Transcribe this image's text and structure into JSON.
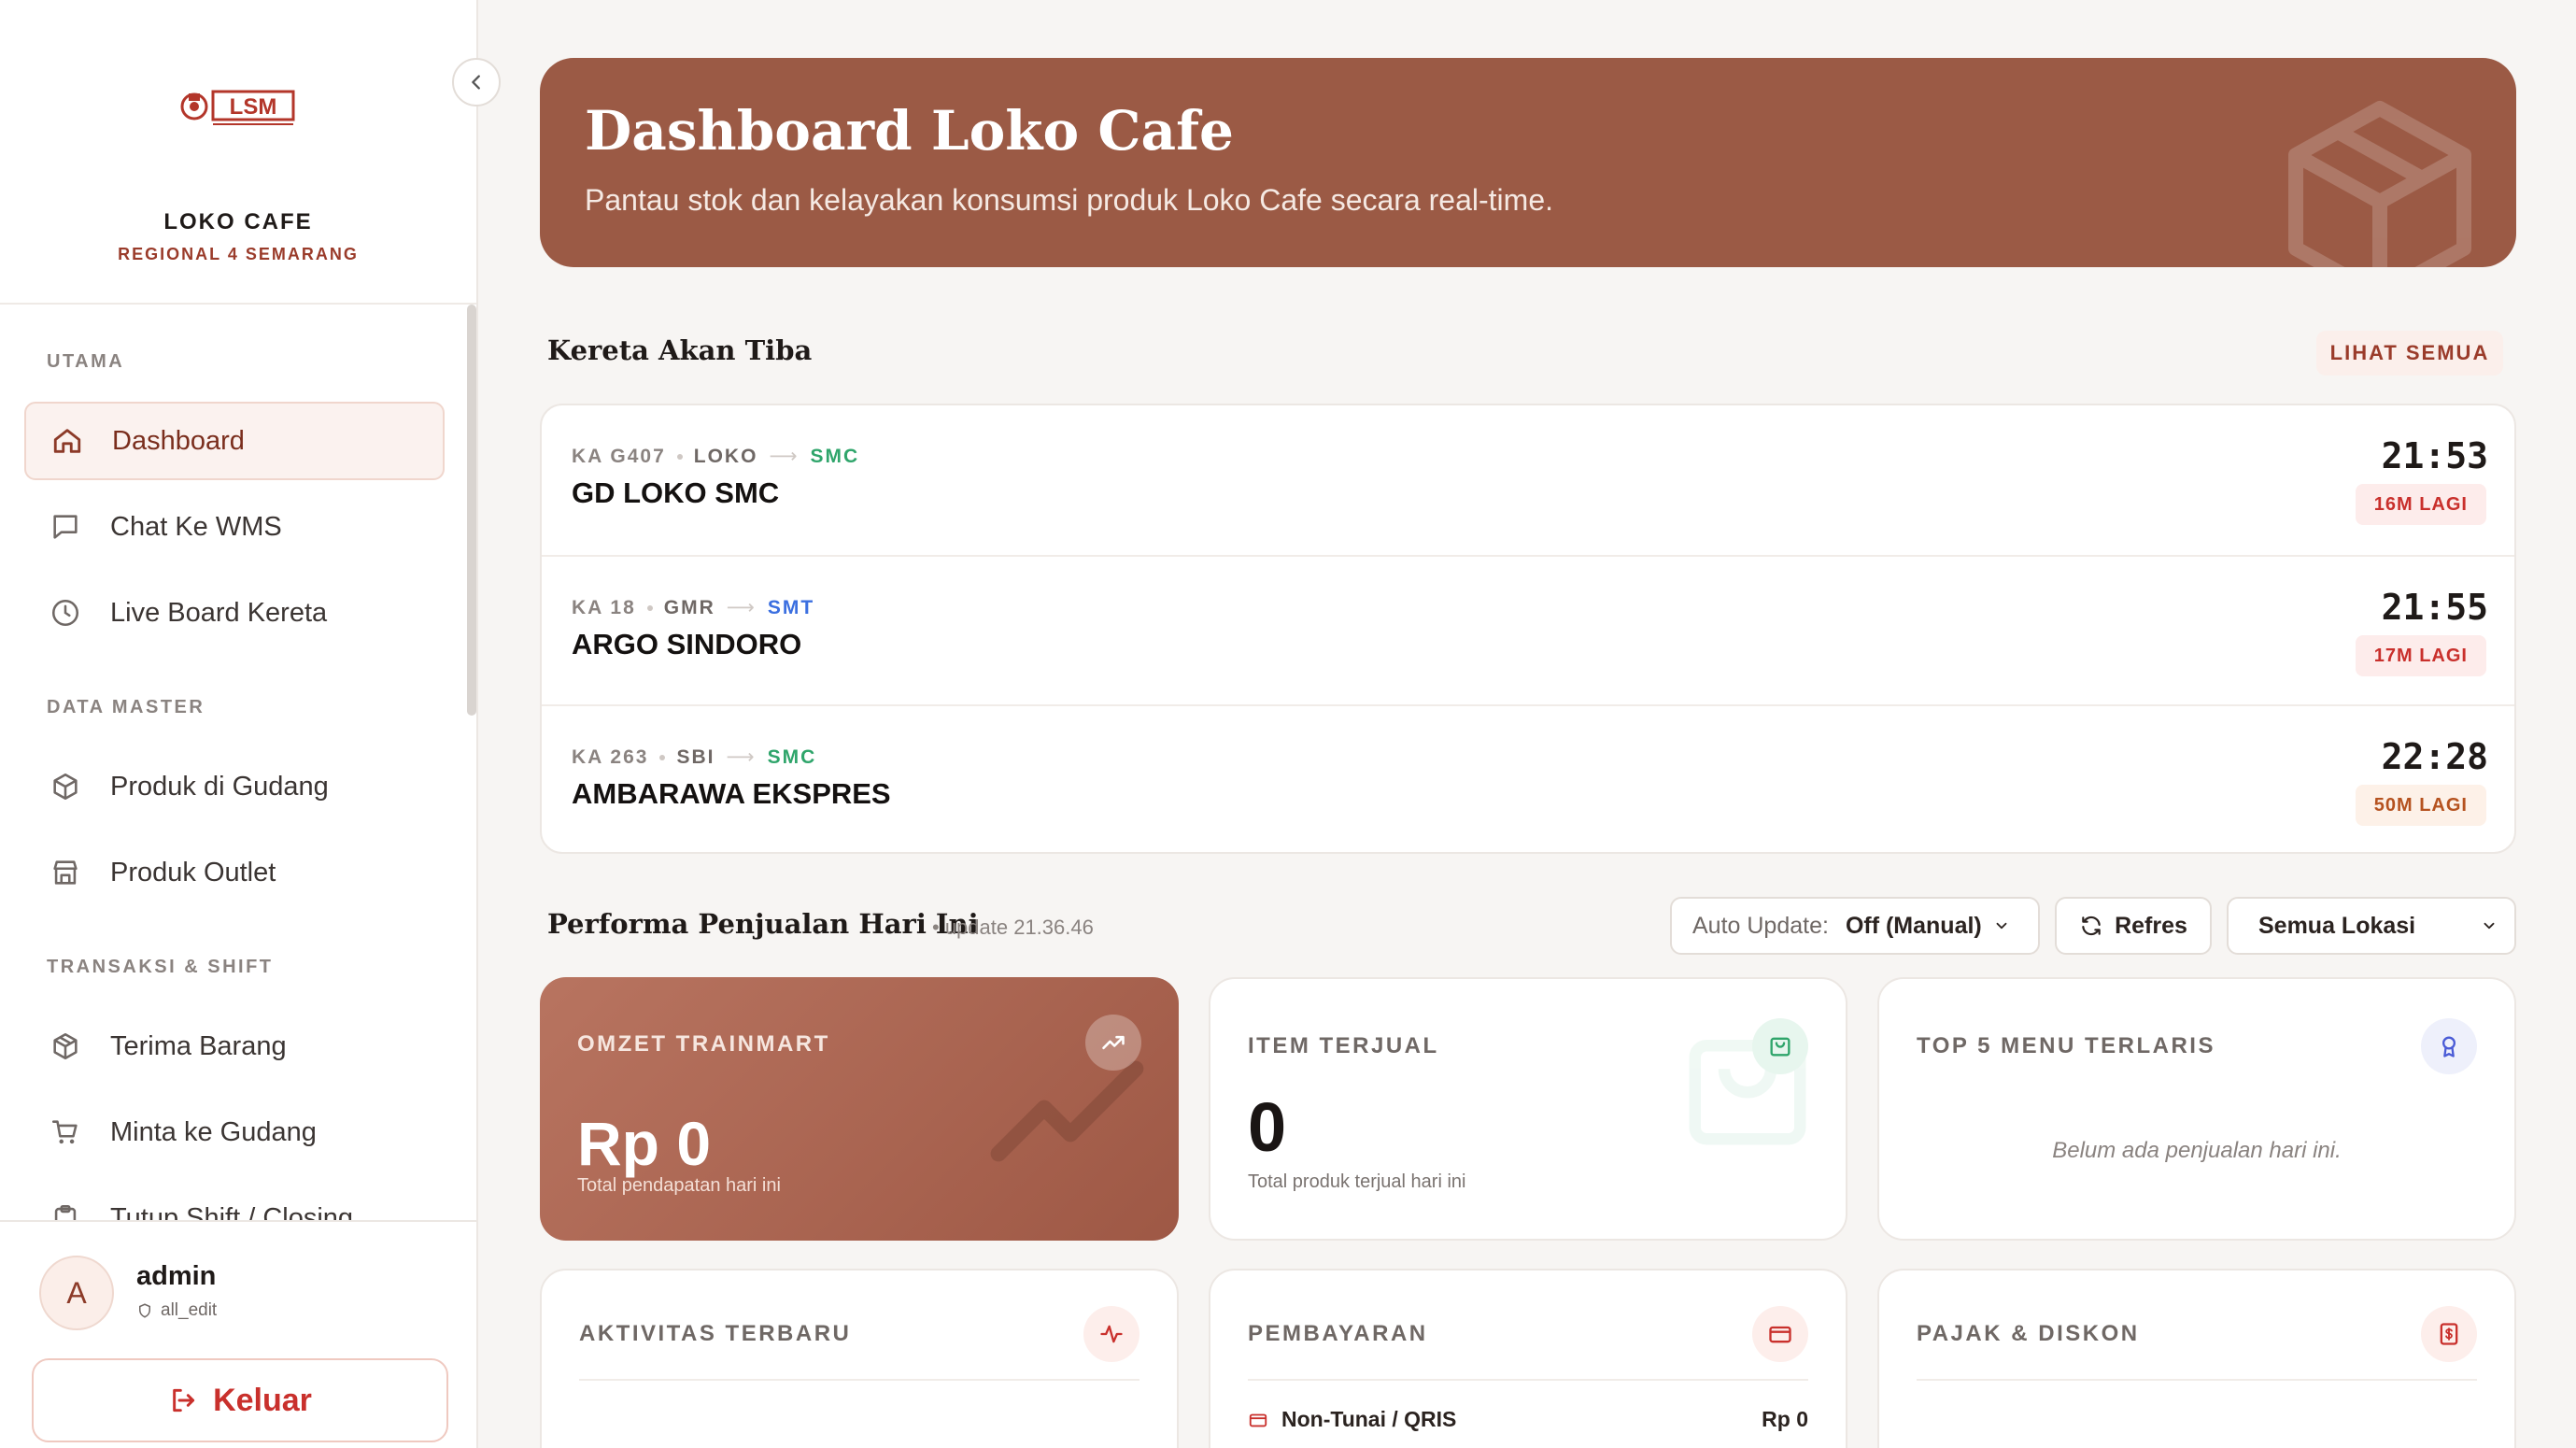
{
  "sidebar": {
    "brand_name": "LOKO CAFE",
    "brand_sub": "REGIONAL 4 SEMARANG",
    "logo_text": "LSM",
    "sections": [
      {
        "label": "UTAMA"
      },
      {
        "label": "DATA MASTER"
      },
      {
        "label": "TRANSAKSI & SHIFT"
      }
    ],
    "items": [
      {
        "label": "Dashboard",
        "icon": "home-icon",
        "active": true
      },
      {
        "label": "Chat Ke WMS",
        "icon": "chat-icon"
      },
      {
        "label": "Live Board Kereta",
        "icon": "clock-icon"
      },
      {
        "label": "Produk di Gudang",
        "icon": "box-icon"
      },
      {
        "label": "Produk Outlet",
        "icon": "store-icon"
      },
      {
        "label": "Terima Barang",
        "icon": "package-icon"
      },
      {
        "label": "Minta ke Gudang",
        "icon": "cart-icon"
      },
      {
        "label": "Tutup Shift / Closing",
        "icon": "clipboard-icon"
      }
    ],
    "user": {
      "initial": "A",
      "name": "admin",
      "role": "all_edit"
    },
    "logout_label": "Keluar"
  },
  "hero": {
    "title": "Dashboard Loko Cafe",
    "subtitle": "Pantau stok dan kelayakan konsumsi produk Loko Cafe secara real-time."
  },
  "arrivals": {
    "title": "Kereta Akan Tiba",
    "see_all": "LIHAT SEMUA",
    "trains": [
      {
        "code": "KA G407",
        "from": "LOKO",
        "to": "SMC",
        "name": "GD LOKO SMC",
        "time": "21:53",
        "eta": "16M LAGI"
      },
      {
        "code": "KA 18",
        "from": "GMR",
        "to": "SMT",
        "name": "ARGO SINDORO",
        "time": "21:55",
        "eta": "17M LAGI"
      },
      {
        "code": "KA 263",
        "from": "SBI",
        "to": "SMC",
        "name": "AMBARAWA EKSPRES",
        "time": "22:28",
        "eta": "50M LAGI"
      }
    ]
  },
  "performance": {
    "title": "Performa Penjualan Hari Ini",
    "update": "• update 21.36.46",
    "auto_update_label": "Auto Update:",
    "auto_update_value": "Off (Manual)",
    "refresh_label": "Refres",
    "location": "Semua Lokasi",
    "omzet": {
      "label": "OMZET TRAINMART",
      "value": "Rp 0",
      "note": "Total pendapatan hari ini"
    },
    "items": {
      "label": "ITEM TERJUAL",
      "value": "0",
      "note": "Total produk terjual hari ini"
    },
    "top5": {
      "label": "TOP 5 MENU TERLARIS",
      "empty": "Belum ada penjualan hari ini."
    },
    "activity": {
      "label": "AKTIVITAS TERBARU"
    },
    "payment": {
      "label": "PEMBAYARAN",
      "rows": [
        {
          "method": "Non-Tunai / QRIS",
          "amount": "Rp 0"
        }
      ]
    },
    "tax": {
      "label": "PAJAK & DISKON"
    }
  },
  "colors": {
    "accent": "#9b5a45",
    "danger": "#c9302c",
    "green": "#2fa56b",
    "blue": "#3b6fe0"
  }
}
